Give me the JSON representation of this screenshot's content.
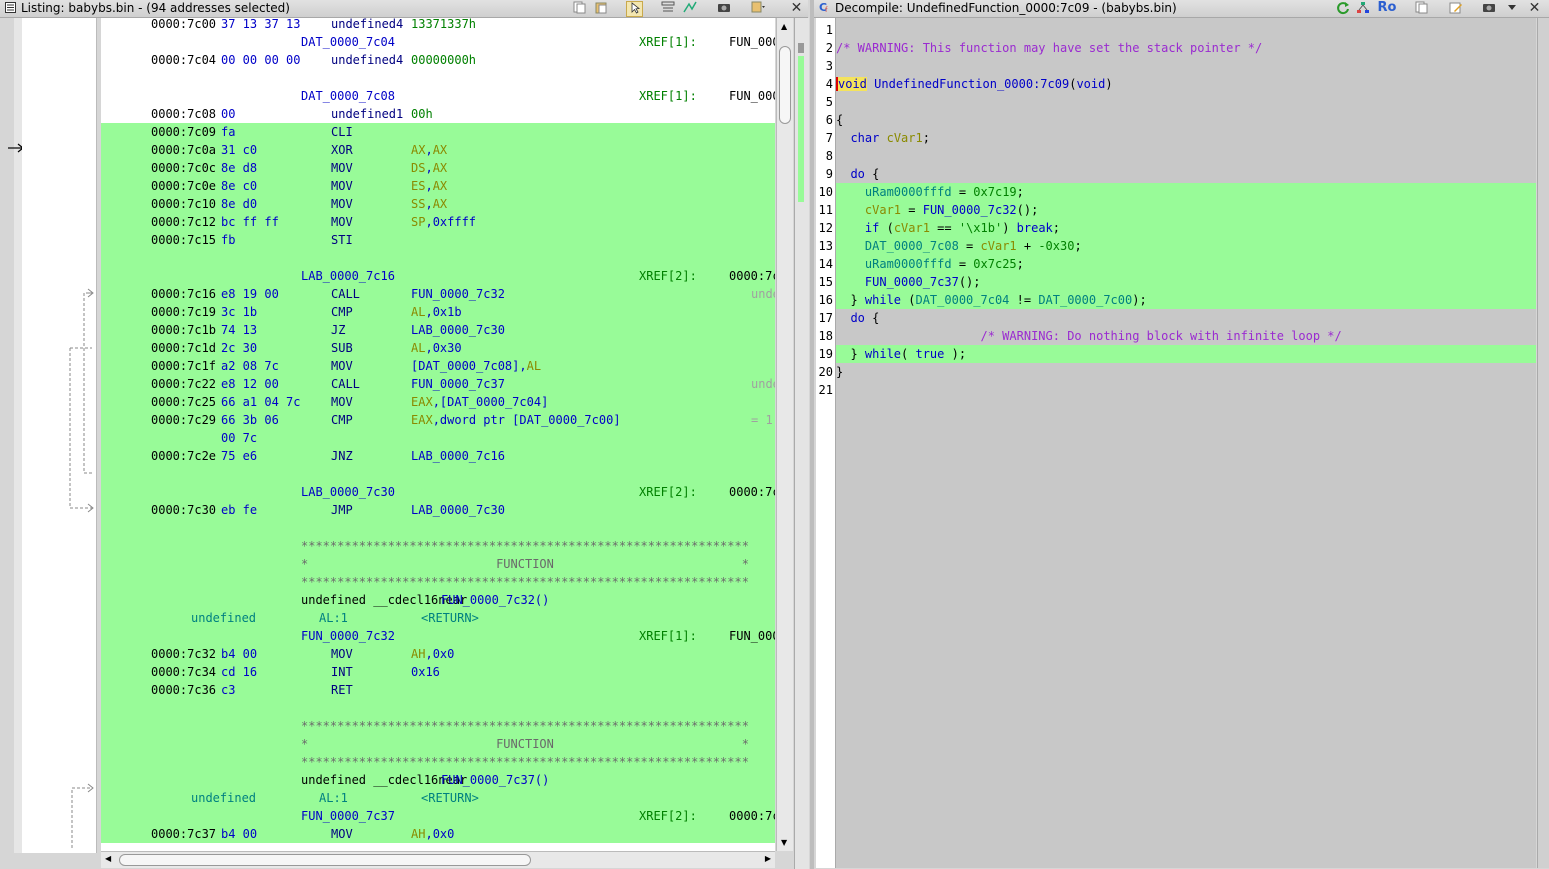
{
  "listing": {
    "title": "Listing:  babybs.bin - (94 addresses selected)",
    "rows": [
      {
        "addr": "0000:7c00",
        "bytes": "37 13 37 13",
        "mnem": "undefined4",
        "opnd": "13371337h",
        "cls": "data",
        "hl": false
      },
      {
        "label": "DAT_0000_7c04",
        "xref": "XREF[1]:",
        "xref_to": "FUN_000",
        "hl": false
      },
      {
        "addr": "0000:7c04",
        "bytes": "00 00 00 00",
        "mnem": "undefined4",
        "opnd": "00000000h",
        "cls": "data",
        "hl": false
      },
      {
        "blank": true
      },
      {
        "label": "DAT_0000_7c08",
        "xref": "XREF[1]:",
        "xref_to": "FUN_000",
        "hl": false
      },
      {
        "addr": "0000:7c08",
        "bytes": "00",
        "mnem": "undefined1",
        "opnd": "00h",
        "cls": "data",
        "hl": false
      },
      {
        "addr": "0000:7c09",
        "bytes": "fa",
        "mnem": "CLI",
        "opnd": "",
        "hl": true
      },
      {
        "addr": "0000:7c0a",
        "bytes": "31 c0",
        "mnem": "XOR",
        "opnd": "AX,AX",
        "hl": true
      },
      {
        "addr": "0000:7c0c",
        "bytes": "8e d8",
        "mnem": "MOV",
        "opnd": "DS,AX",
        "hl": true
      },
      {
        "addr": "0000:7c0e",
        "bytes": "8e c0",
        "mnem": "MOV",
        "opnd": "ES,AX",
        "hl": true
      },
      {
        "addr": "0000:7c10",
        "bytes": "8e d0",
        "mnem": "MOV",
        "opnd": "SS,AX",
        "hl": true
      },
      {
        "addr": "0000:7c12",
        "bytes": "bc ff ff",
        "mnem": "MOV",
        "opnd": "SP,0xffff",
        "hl": true
      },
      {
        "addr": "0000:7c15",
        "bytes": "fb",
        "mnem": "STI",
        "opnd": "",
        "hl": true
      },
      {
        "blank": true,
        "hl": true
      },
      {
        "label": "LAB_0000_7c16",
        "xref": "XREF[2]:",
        "xref_to": "0000:7c",
        "hl": true
      },
      {
        "addr": "0000:7c16",
        "bytes": "e8 19 00",
        "mnem": "CALL",
        "opnd": "FUN_0000_7c32",
        "hl": true,
        "side": "unde"
      },
      {
        "addr": "0000:7c19",
        "bytes": "3c 1b",
        "mnem": "CMP",
        "opnd": "AL,0x1b",
        "hl": true
      },
      {
        "addr": "0000:7c1b",
        "bytes": "74 13",
        "mnem": "JZ",
        "opnd": "LAB_0000_7c30",
        "hl": true
      },
      {
        "addr": "0000:7c1d",
        "bytes": "2c 30",
        "mnem": "SUB",
        "opnd": "AL,0x30",
        "hl": true
      },
      {
        "addr": "0000:7c1f",
        "bytes": "a2 08 7c",
        "mnem": "MOV",
        "opnd": "[DAT_0000_7c08],AL",
        "hl": true
      },
      {
        "addr": "0000:7c22",
        "bytes": "e8 12 00",
        "mnem": "CALL",
        "opnd": "FUN_0000_7c37",
        "hl": true,
        "side": "unde"
      },
      {
        "addr": "0000:7c25",
        "bytes": "66 a1 04 7c",
        "mnem": "MOV",
        "opnd": "EAX,[DAT_0000_7c04]",
        "hl": true
      },
      {
        "addr": "0000:7c29",
        "bytes": "66 3b 06",
        "mnem": "CMP",
        "opnd": "EAX,dword ptr [DAT_0000_7c00]",
        "hl": true,
        "side": "= 1"
      },
      {
        "addr": "",
        "bytes": "00 7c",
        "mnem": "",
        "opnd": "",
        "hl": true
      },
      {
        "addr": "0000:7c2e",
        "bytes": "75 e6",
        "mnem": "JNZ",
        "opnd": "LAB_0000_7c16",
        "hl": true
      },
      {
        "blank": true,
        "hl": true
      },
      {
        "label": "LAB_0000_7c30",
        "xref": "XREF[2]:",
        "xref_to": "0000:7c",
        "hl": true
      },
      {
        "addr": "0000:7c30",
        "bytes": "eb fe",
        "mnem": "JMP",
        "opnd": "LAB_0000_7c30",
        "hl": true
      },
      {
        "blank": true,
        "hl": true
      },
      {
        "stars": "**************************************************************",
        "hl": true
      },
      {
        "func_banner": "*                          FUNCTION                          *",
        "hl": true
      },
      {
        "stars": "**************************************************************",
        "hl": true
      },
      {
        "sig": "undefined __cdecl16near ",
        "sigfn": "FUN_0000_7c32()",
        "hl": true
      },
      {
        "ret_type": "undefined",
        "ret_loc": "AL:1",
        "ret_name": "<RETURN>",
        "hl": true
      },
      {
        "label": "FUN_0000_7c32",
        "xref": "XREF[1]:",
        "xref_to": "FUN_000",
        "hl": true
      },
      {
        "addr": "0000:7c32",
        "bytes": "b4 00",
        "mnem": "MOV",
        "opnd": "AH,0x0",
        "hl": true
      },
      {
        "addr": "0000:7c34",
        "bytes": "cd 16",
        "mnem": "INT",
        "opnd": "0x16",
        "hl": true
      },
      {
        "addr": "0000:7c36",
        "bytes": "c3",
        "mnem": "RET",
        "opnd": "",
        "hl": true
      },
      {
        "blank": true,
        "hl": true
      },
      {
        "stars": "**************************************************************",
        "hl": true
      },
      {
        "func_banner": "*                          FUNCTION                          *",
        "hl": true
      },
      {
        "stars": "**************************************************************",
        "hl": true
      },
      {
        "sig": "undefined __cdecl16near ",
        "sigfn": "FUN_0000_7c37()",
        "hl": true
      },
      {
        "ret_type": "undefined",
        "ret_loc": "AL:1",
        "ret_name": "<RETURN>",
        "hl": true
      },
      {
        "label": "FUN_0000_7c37",
        "xref": "XREF[2]:",
        "xref_to": "0000:7c",
        "hl": true
      },
      {
        "addr": "0000:7c37",
        "bytes": "b4 00",
        "mnem": "MOV",
        "opnd": "AH,0x0",
        "hl": true
      }
    ]
  },
  "decompile": {
    "title": "Decompile: UndefinedFunction_0000:7c09 -  (babybs.bin)",
    "title_ro": "Ro",
    "lines": [
      {
        "n": "1",
        "hl": false,
        "parts": []
      },
      {
        "n": "2",
        "hl": false,
        "parts": [
          {
            "t": "/* WARNING: This function may have set the stack pointer */",
            "c": "cmt"
          }
        ]
      },
      {
        "n": "3",
        "hl": false,
        "parts": []
      },
      {
        "n": "4",
        "hl": false,
        "parts": [
          {
            "t": "void",
            "c": "kw"
          },
          {
            "t": " ",
            "c": ""
          },
          {
            "t": "UndefinedFunction_0000:7c09",
            "c": "fn"
          },
          {
            "t": "(",
            "c": ""
          },
          {
            "t": "void",
            "c": "kw"
          },
          {
            "t": ")",
            "c": ""
          }
        ]
      },
      {
        "n": "5",
        "hl": false,
        "parts": []
      },
      {
        "n": "6",
        "hl": false,
        "parts": [
          {
            "t": "{",
            "c": ""
          }
        ]
      },
      {
        "n": "7",
        "hl": false,
        "parts": [
          {
            "t": "  ",
            "c": ""
          },
          {
            "t": "char",
            "c": "kw"
          },
          {
            "t": " ",
            "c": ""
          },
          {
            "t": "cVar1",
            "c": "var"
          },
          {
            "t": ";",
            "c": ""
          }
        ]
      },
      {
        "n": "8",
        "hl": false,
        "parts": []
      },
      {
        "n": "9",
        "hl": false,
        "parts": [
          {
            "t": "  ",
            "c": ""
          },
          {
            "t": "do",
            "c": "kw"
          },
          {
            "t": " {",
            "c": ""
          }
        ]
      },
      {
        "n": "10",
        "hl": true,
        "parts": [
          {
            "t": "    ",
            "c": ""
          },
          {
            "t": "uRam0000fffd",
            "c": "glob"
          },
          {
            "t": " = ",
            "c": ""
          },
          {
            "t": "0x7c19",
            "c": "num"
          },
          {
            "t": ";",
            "c": ""
          }
        ]
      },
      {
        "n": "11",
        "hl": true,
        "parts": [
          {
            "t": "    ",
            "c": ""
          },
          {
            "t": "cVar1",
            "c": "var"
          },
          {
            "t": " = ",
            "c": ""
          },
          {
            "t": "FUN_0000_7c32",
            "c": "fn"
          },
          {
            "t": "();",
            "c": ""
          }
        ]
      },
      {
        "n": "12",
        "hl": true,
        "parts": [
          {
            "t": "    ",
            "c": ""
          },
          {
            "t": "if",
            "c": "kw"
          },
          {
            "t": " (",
            "c": ""
          },
          {
            "t": "cVar1",
            "c": "var"
          },
          {
            "t": " == ",
            "c": ""
          },
          {
            "t": "'\\x1b'",
            "c": "str"
          },
          {
            "t": ") ",
            "c": ""
          },
          {
            "t": "break",
            "c": "kw"
          },
          {
            "t": ";",
            "c": ""
          }
        ]
      },
      {
        "n": "13",
        "hl": true,
        "parts": [
          {
            "t": "    ",
            "c": ""
          },
          {
            "t": "DAT_0000_7c08",
            "c": "glob"
          },
          {
            "t": " = ",
            "c": ""
          },
          {
            "t": "cVar1",
            "c": "var"
          },
          {
            "t": " + ",
            "c": ""
          },
          {
            "t": "-0x30",
            "c": "num"
          },
          {
            "t": ";",
            "c": ""
          }
        ]
      },
      {
        "n": "14",
        "hl": true,
        "parts": [
          {
            "t": "    ",
            "c": ""
          },
          {
            "t": "uRam0000fffd",
            "c": "glob"
          },
          {
            "t": " = ",
            "c": ""
          },
          {
            "t": "0x7c25",
            "c": "num"
          },
          {
            "t": ";",
            "c": ""
          }
        ]
      },
      {
        "n": "15",
        "hl": true,
        "parts": [
          {
            "t": "    ",
            "c": ""
          },
          {
            "t": "FUN_0000_7c37",
            "c": "fn"
          },
          {
            "t": "();",
            "c": ""
          }
        ]
      },
      {
        "n": "16",
        "hl": true,
        "parts": [
          {
            "t": "  } ",
            "c": ""
          },
          {
            "t": "while",
            "c": "kw"
          },
          {
            "t": " (",
            "c": ""
          },
          {
            "t": "DAT_0000_7c04",
            "c": "glob"
          },
          {
            "t": " != ",
            "c": ""
          },
          {
            "t": "DAT_0000_7c00",
            "c": "glob"
          },
          {
            "t": ");",
            "c": ""
          }
        ]
      },
      {
        "n": "17",
        "hl": false,
        "parts": [
          {
            "t": "  ",
            "c": ""
          },
          {
            "t": "do",
            "c": "kw"
          },
          {
            "t": " {",
            "c": ""
          }
        ]
      },
      {
        "n": "18",
        "hl": false,
        "parts": [
          {
            "t": "                    ",
            "c": ""
          },
          {
            "t": "/* WARNING: Do nothing block with infinite loop */",
            "c": "cmt"
          }
        ]
      },
      {
        "n": "19",
        "hl": true,
        "parts": [
          {
            "t": "  } ",
            "c": ""
          },
          {
            "t": "while",
            "c": "kw"
          },
          {
            "t": "( ",
            "c": ""
          },
          {
            "t": "true",
            "c": "kw"
          },
          {
            "t": " );",
            "c": ""
          }
        ]
      },
      {
        "n": "20",
        "hl": false,
        "parts": [
          {
            "t": "}",
            "c": ""
          }
        ]
      },
      {
        "n": "21",
        "hl": false,
        "parts": []
      }
    ]
  }
}
